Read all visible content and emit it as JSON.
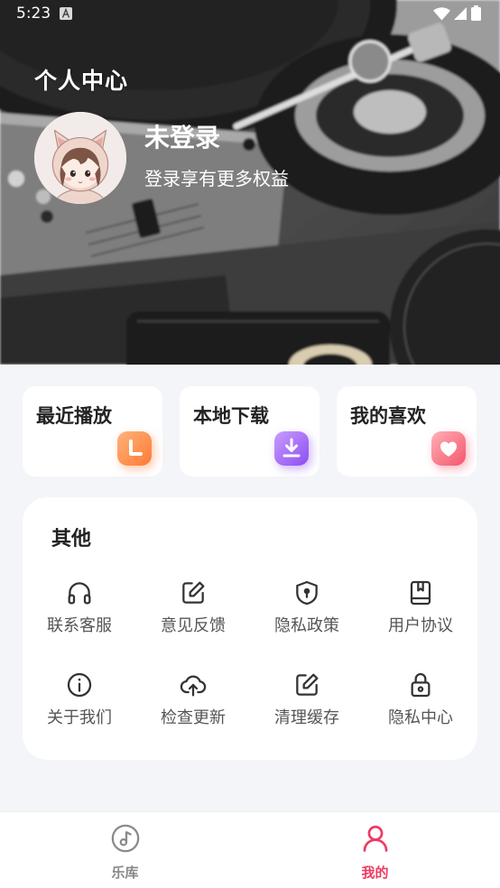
{
  "status_bar": {
    "time": "5:23",
    "icons": [
      "a-icon",
      "wifi-icon",
      "signal-icon",
      "battery-icon"
    ]
  },
  "header": {
    "title": "个人中心",
    "username": "未登录",
    "subtitle": "登录享有更多权益",
    "avatar_icon": "avatar-cat-hood-girl",
    "background_image": "turntable-photo-grayscale"
  },
  "quick_cards": [
    {
      "label": "最近播放",
      "icon": "clock-icon",
      "color_from": "#ffb27a",
      "color_to": "#ff7a35"
    },
    {
      "label": "本地下载",
      "icon": "download-icon",
      "color_from": "#c99cff",
      "color_to": "#8b4ef2"
    },
    {
      "label": "我的喜欢",
      "icon": "heart-icon",
      "color_from": "#ffb0b6",
      "color_to": "#f4566b"
    }
  ],
  "other": {
    "title": "其他",
    "items": [
      {
        "label": "联系客服",
        "icon": "headphones-icon"
      },
      {
        "label": "意见反馈",
        "icon": "edit-icon"
      },
      {
        "label": "隐私政策",
        "icon": "shield-icon"
      },
      {
        "label": "用户协议",
        "icon": "book-icon"
      },
      {
        "label": "关于我们",
        "icon": "info-icon"
      },
      {
        "label": "检查更新",
        "icon": "cloud-upload-icon"
      },
      {
        "label": "清理缓存",
        "icon": "edit-icon"
      },
      {
        "label": "隐私中心",
        "icon": "lock-icon"
      }
    ]
  },
  "tab_bar": {
    "items": [
      {
        "label": "乐库",
        "icon": "music-disc-icon",
        "active": false
      },
      {
        "label": "我的",
        "icon": "person-icon",
        "active": true
      }
    ]
  },
  "colors": {
    "accent": "#ee3a63",
    "page_background": "#f4f5f9",
    "card_background": "#ffffff",
    "text_primary": "#222222",
    "text_secondary": "#555555",
    "tab_inactive": "#888888"
  }
}
